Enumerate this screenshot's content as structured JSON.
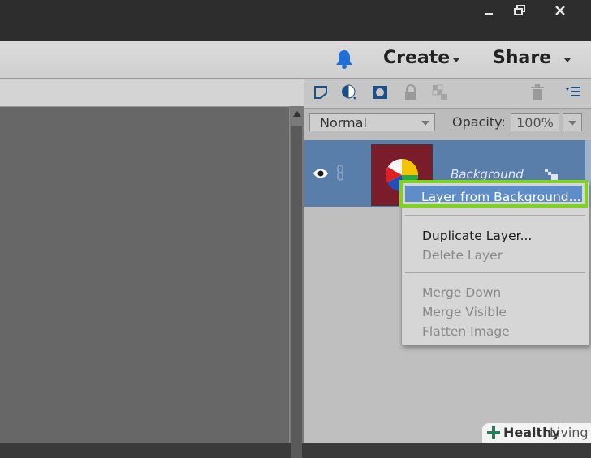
{
  "window": {
    "minimize_icon": "minimize-icon",
    "maximize_icon": "restore-icon",
    "close_icon": "close-icon"
  },
  "menubar": {
    "notification_icon": "bell-icon",
    "create_label": "Create",
    "share_label": "Share",
    "accent_color": "#1f6fd6"
  },
  "layers_panel": {
    "toolbar_icons": [
      "new-layer-icon",
      "adjustment-layer-icon",
      "layer-mask-icon",
      "lock-all-icon",
      "lock-transparent-icon",
      "trash-icon",
      "panel-menu-icon"
    ],
    "blend_mode": "Normal",
    "opacity_label": "Opacity:",
    "opacity_value": "100%",
    "layer": {
      "name": "Background",
      "visibility_icon": "eye-icon",
      "link_icon": "link-icon",
      "lock_icon": "lock-icon",
      "thumbnail": "beach-ball-thumbnail",
      "selected_color": "#5a7eaa"
    }
  },
  "context_menu": {
    "highlight_color": "#7ed321",
    "items": [
      {
        "label": "Layer from Background...",
        "enabled": true,
        "highlighted": true
      },
      {
        "label": "Duplicate Layer...",
        "enabled": true
      },
      {
        "label": "Delete Layer",
        "enabled": false
      },
      {
        "label": "Merge Down",
        "enabled": false
      },
      {
        "label": "Merge Visible",
        "enabled": false
      },
      {
        "label": "Flatten Image",
        "enabled": false
      }
    ]
  },
  "watermark": {
    "text_bold": "Healthy",
    "text_regular": "Living"
  }
}
